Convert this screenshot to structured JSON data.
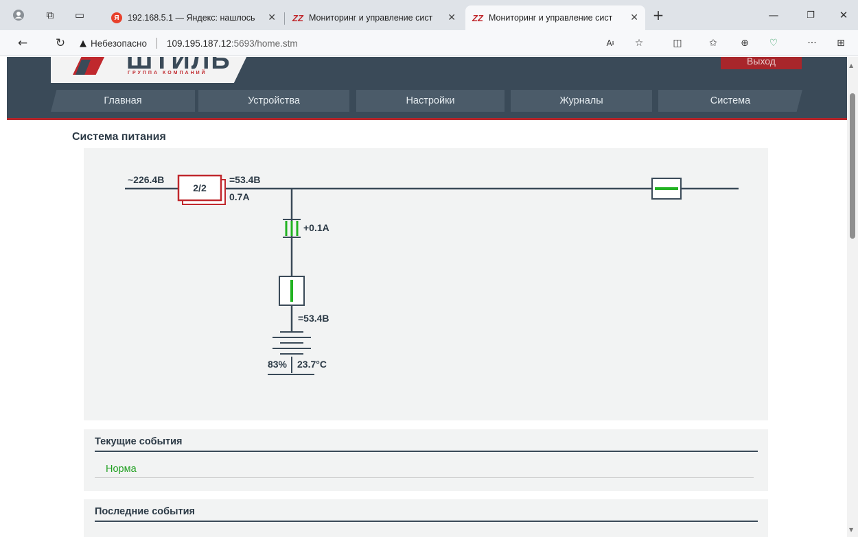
{
  "browser": {
    "tabs": [
      {
        "label": "192.168.5.1 — Яндекс: нашлось",
        "favicon": "yandex-icon"
      },
      {
        "label": "Мониторинг и управление сист",
        "favicon": "stulz-icon"
      },
      {
        "label": "Мониторинг и управление сист",
        "favicon": "stulz-icon"
      }
    ],
    "security_label": "Небезопасно",
    "url_host": "109.195.187.12",
    "url_rest": ":5693/home.stm"
  },
  "header": {
    "logo_text": "ШТИЛЬ",
    "logo_sub": "ГРУППА КОМПАНИЙ",
    "logout_label": "Выход"
  },
  "menu": {
    "items": [
      "Главная",
      "Устройства",
      "Настройки",
      "Журналы",
      "Система"
    ]
  },
  "power": {
    "title": "Система питания",
    "input_voltage": "~226.4В",
    "rectifiers": "2/2",
    "output_voltage": "=53.4В",
    "load_current": "0.7А",
    "battery_current": "+0.1А",
    "battery_voltage": "=53.4В",
    "battery_charge": "83%",
    "battery_temp": "23.7°С",
    "colors": {
      "line": "#3a4a58",
      "ok": "#22b322",
      "rectifier": "#c0282d"
    }
  },
  "current_events": {
    "title": "Текущие события",
    "status": "Норма"
  },
  "last_events": {
    "title": "Последние события"
  }
}
